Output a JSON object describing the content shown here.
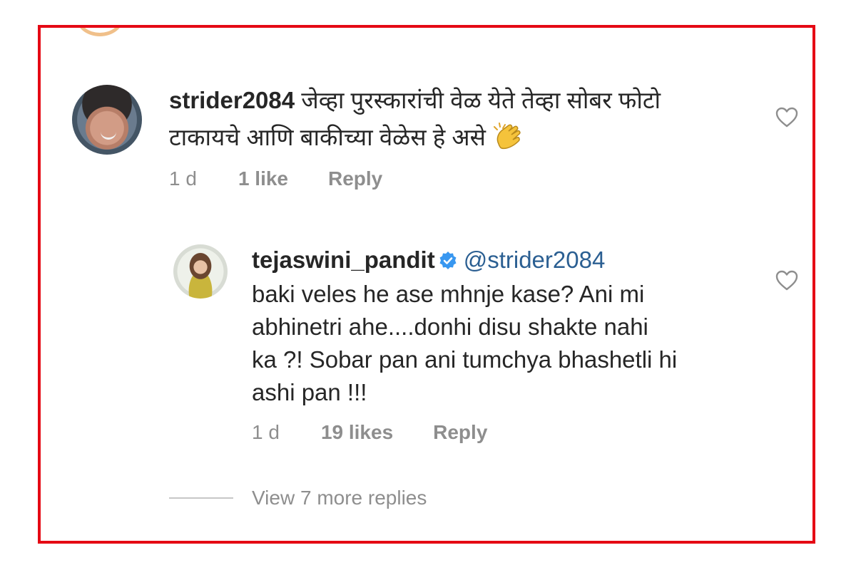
{
  "comments": [
    {
      "username": "strider2084",
      "text_line1": "जेव्हा पुरस्कारांची वेळ येते तेव्हा सोबर फोटो",
      "text_line2": "टाकायचे आणि बाकीच्या वेळेस हे असे",
      "emoji": "clapping-hands-icon",
      "time": "1 d",
      "likes": "1 like",
      "reply_label": "Reply"
    },
    {
      "username": "tejaswini_pandit",
      "verified": true,
      "mention": "@strider2084",
      "text_line1": "baki veles he ase mhnje kase? Ani mi",
      "text_line2": "abhinetri ahe....donhi disu shakte nahi",
      "text_line3": "ka ?! Sobar pan ani tumchya bhashetli hi",
      "text_line4": "ashi pan !!!",
      "time": "1 d",
      "likes": "19 likes",
      "reply_label": "Reply"
    }
  ],
  "view_more_replies": "View 7 more replies",
  "colors": {
    "frame_border": "#e50914",
    "text": "#262626",
    "meta": "#8e8e8e",
    "mention": "#2b5f92",
    "verified_badge": "#3897f0"
  }
}
